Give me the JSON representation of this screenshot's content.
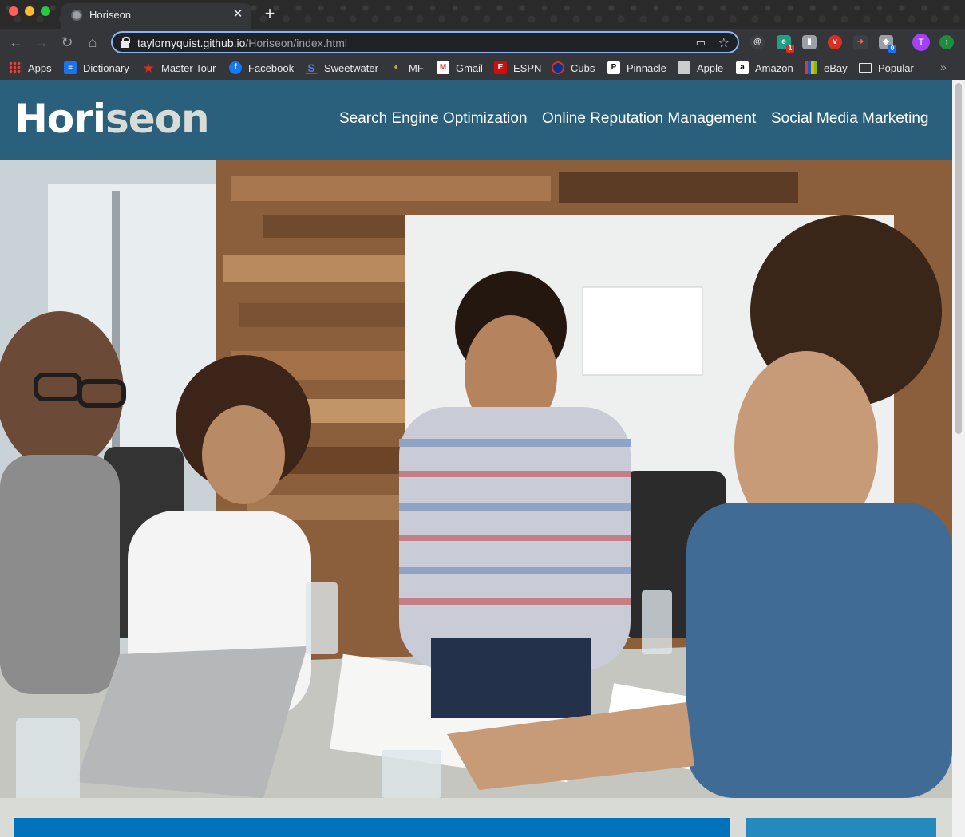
{
  "browser": {
    "tab_title": "Horiseon",
    "url_host": "taylornyquist.github.io",
    "url_path": "/Horiseon/index.html",
    "profile_initial": "T",
    "extension_badges": [
      "1",
      "0"
    ]
  },
  "bookmarks": [
    {
      "label": "Apps",
      "icon": "apps-grid-icon",
      "color": "#4285f4"
    },
    {
      "label": "Dictionary",
      "icon": "dictionary-icon",
      "color": "#1a73e8"
    },
    {
      "label": "Master Tour",
      "icon": "master-tour-icon",
      "color": "#d93025"
    },
    {
      "label": "Facebook",
      "icon": "facebook-icon",
      "color": "#1877f2"
    },
    {
      "label": "Sweetwater",
      "icon": "sweetwater-icon",
      "color": "#2d4e9a"
    },
    {
      "label": "MF",
      "icon": "mf-icon",
      "color": "#8d6e3f"
    },
    {
      "label": "Gmail",
      "icon": "gmail-icon",
      "color": "#ea4335"
    },
    {
      "label": "ESPN",
      "icon": "espn-icon",
      "color": "#d50a0a"
    },
    {
      "label": "Cubs",
      "icon": "cubs-icon",
      "color": "#0e3386"
    },
    {
      "label": "Pinnacle",
      "icon": "pinnacle-icon",
      "color": "#ffffff"
    },
    {
      "label": "Apple",
      "icon": "apple-icon",
      "color": "#cccccc"
    },
    {
      "label": "Amazon",
      "icon": "amazon-icon",
      "color": "#ffffff"
    },
    {
      "label": "eBay",
      "icon": "ebay-icon",
      "color": "#e53238"
    },
    {
      "label": "Popular",
      "icon": "folder-icon",
      "color": "#e8eaed"
    }
  ],
  "site": {
    "logo_main": "Hori",
    "logo_accent": "seon",
    "nav": [
      {
        "label": "Search Engine Optimization"
      },
      {
        "label": "Online Reputation Management"
      },
      {
        "label": "Social Media Marketing"
      }
    ],
    "hero_image": "team-meeting-photo"
  },
  "colors": {
    "header_bg": "#2a607c",
    "page_bg": "#d9dcd6",
    "section_blue": "#0072bb",
    "aside_blue": "#2589bd"
  }
}
